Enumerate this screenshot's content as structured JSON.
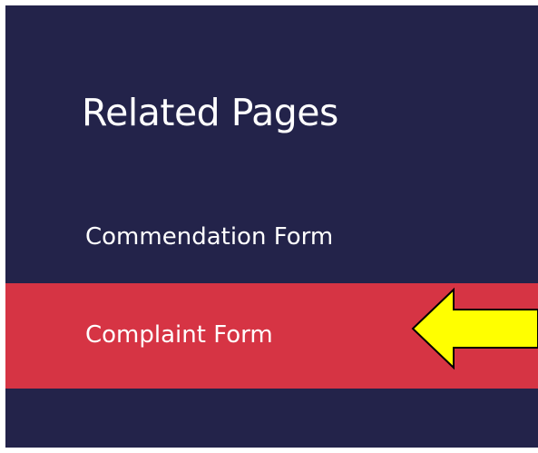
{
  "sidebar": {
    "heading": "Related Pages",
    "items": [
      {
        "label": "Commendation Form",
        "active": false
      },
      {
        "label": "Complaint Form",
        "active": true
      }
    ]
  },
  "annotation": {
    "icon": "left-arrow-icon",
    "fill_color": "#ffff00",
    "stroke_color": "#000000"
  },
  "colors": {
    "background": "#23234a",
    "active_item": "#d63444",
    "text": "#ffffff"
  }
}
